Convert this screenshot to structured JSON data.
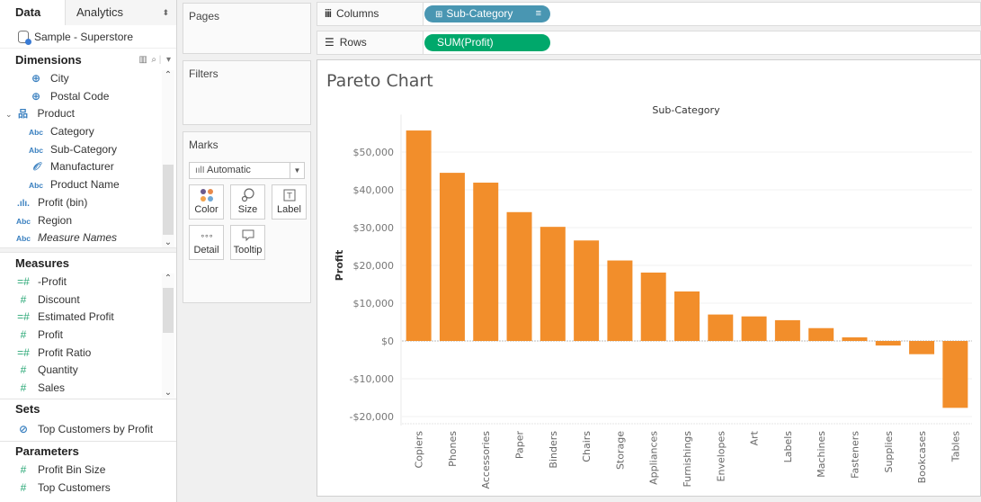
{
  "left_pane": {
    "tabs": [
      {
        "label": "Data",
        "active": true
      },
      {
        "label": "Analytics",
        "active": false
      }
    ],
    "datasource": "Sample - Superstore",
    "dimensions": {
      "title": "Dimensions",
      "items": [
        {
          "label": "City",
          "icon": "globe-icon",
          "indent": 2
        },
        {
          "label": "Postal Code",
          "icon": "globe-icon",
          "indent": 2
        },
        {
          "label": "Product",
          "icon": "hierarchy-icon",
          "indent": 1,
          "expanded": true
        },
        {
          "label": "Category",
          "icon": "abc-icon",
          "indent": 2
        },
        {
          "label": "Sub-Category",
          "icon": "abc-icon",
          "indent": 2
        },
        {
          "label": "Manufacturer",
          "icon": "paperclip-icon",
          "indent": 2
        },
        {
          "label": "Product Name",
          "icon": "abc-icon",
          "indent": 2
        },
        {
          "label": "Profit (bin)",
          "icon": "histogram-icon",
          "indent": 1
        },
        {
          "label": "Region",
          "icon": "abc-icon",
          "indent": 1
        },
        {
          "label": "Measure Names",
          "icon": "abc-icon",
          "indent": 1,
          "italic": true
        }
      ]
    },
    "measures": {
      "title": "Measures",
      "items": [
        {
          "label": "-Profit",
          "icon": "calc-number-icon"
        },
        {
          "label": "Discount",
          "icon": "number-icon"
        },
        {
          "label": "Estimated Profit",
          "icon": "calc-number-icon"
        },
        {
          "label": "Profit",
          "icon": "number-icon"
        },
        {
          "label": "Profit Ratio",
          "icon": "calc-number-icon"
        },
        {
          "label": "Quantity",
          "icon": "number-icon"
        },
        {
          "label": "Sales",
          "icon": "number-icon"
        }
      ]
    },
    "sets": {
      "title": "Sets",
      "items": [
        {
          "label": "Top Customers by Profit",
          "icon": "set-icon"
        }
      ]
    },
    "parameters": {
      "title": "Parameters",
      "items": [
        {
          "label": "Profit Bin Size",
          "icon": "number-icon"
        },
        {
          "label": "Top Customers",
          "icon": "number-icon"
        }
      ]
    }
  },
  "cards": {
    "pages": "Pages",
    "filters": "Filters",
    "marks": {
      "title": "Marks",
      "type": "Automatic",
      "buttons": [
        "Color",
        "Size",
        "Label",
        "Detail",
        "Tooltip"
      ]
    }
  },
  "shelves": {
    "columns": {
      "label": "Columns",
      "pill": "Sub-Category"
    },
    "rows": {
      "label": "Rows",
      "pill": "SUM(Profit)"
    }
  },
  "colors": {
    "bar": "#f28e2b",
    "dimension_pill": "#4996b2",
    "measure_pill": "#00a86b"
  },
  "chart_data": {
    "type": "bar",
    "title": "Pareto Chart",
    "header": "Sub-Category",
    "xlabel": "",
    "ylabel": "Profit",
    "categories": [
      "Copiers",
      "Phones",
      "Accessories",
      "Paper",
      "Binders",
      "Chairs",
      "Storage",
      "Appliances",
      "Furnishings",
      "Envelopes",
      "Art",
      "Labels",
      "Machines",
      "Fasteners",
      "Supplies",
      "Bookcases",
      "Tables"
    ],
    "values": [
      55700,
      44500,
      41900,
      34100,
      30200,
      26600,
      21300,
      18100,
      13100,
      7000,
      6500,
      5500,
      3400,
      950,
      -1200,
      -3500,
      -17700
    ],
    "ylim": [
      -20000,
      58000
    ],
    "yticks": [
      -20000,
      -10000,
      0,
      10000,
      20000,
      30000,
      40000,
      50000
    ],
    "ytick_labels": [
      "-$20,000",
      "-$10,000",
      "$0",
      "$10,000",
      "$20,000",
      "$30,000",
      "$40,000",
      "$50,000"
    ],
    "grid": true,
    "legend": "none"
  }
}
